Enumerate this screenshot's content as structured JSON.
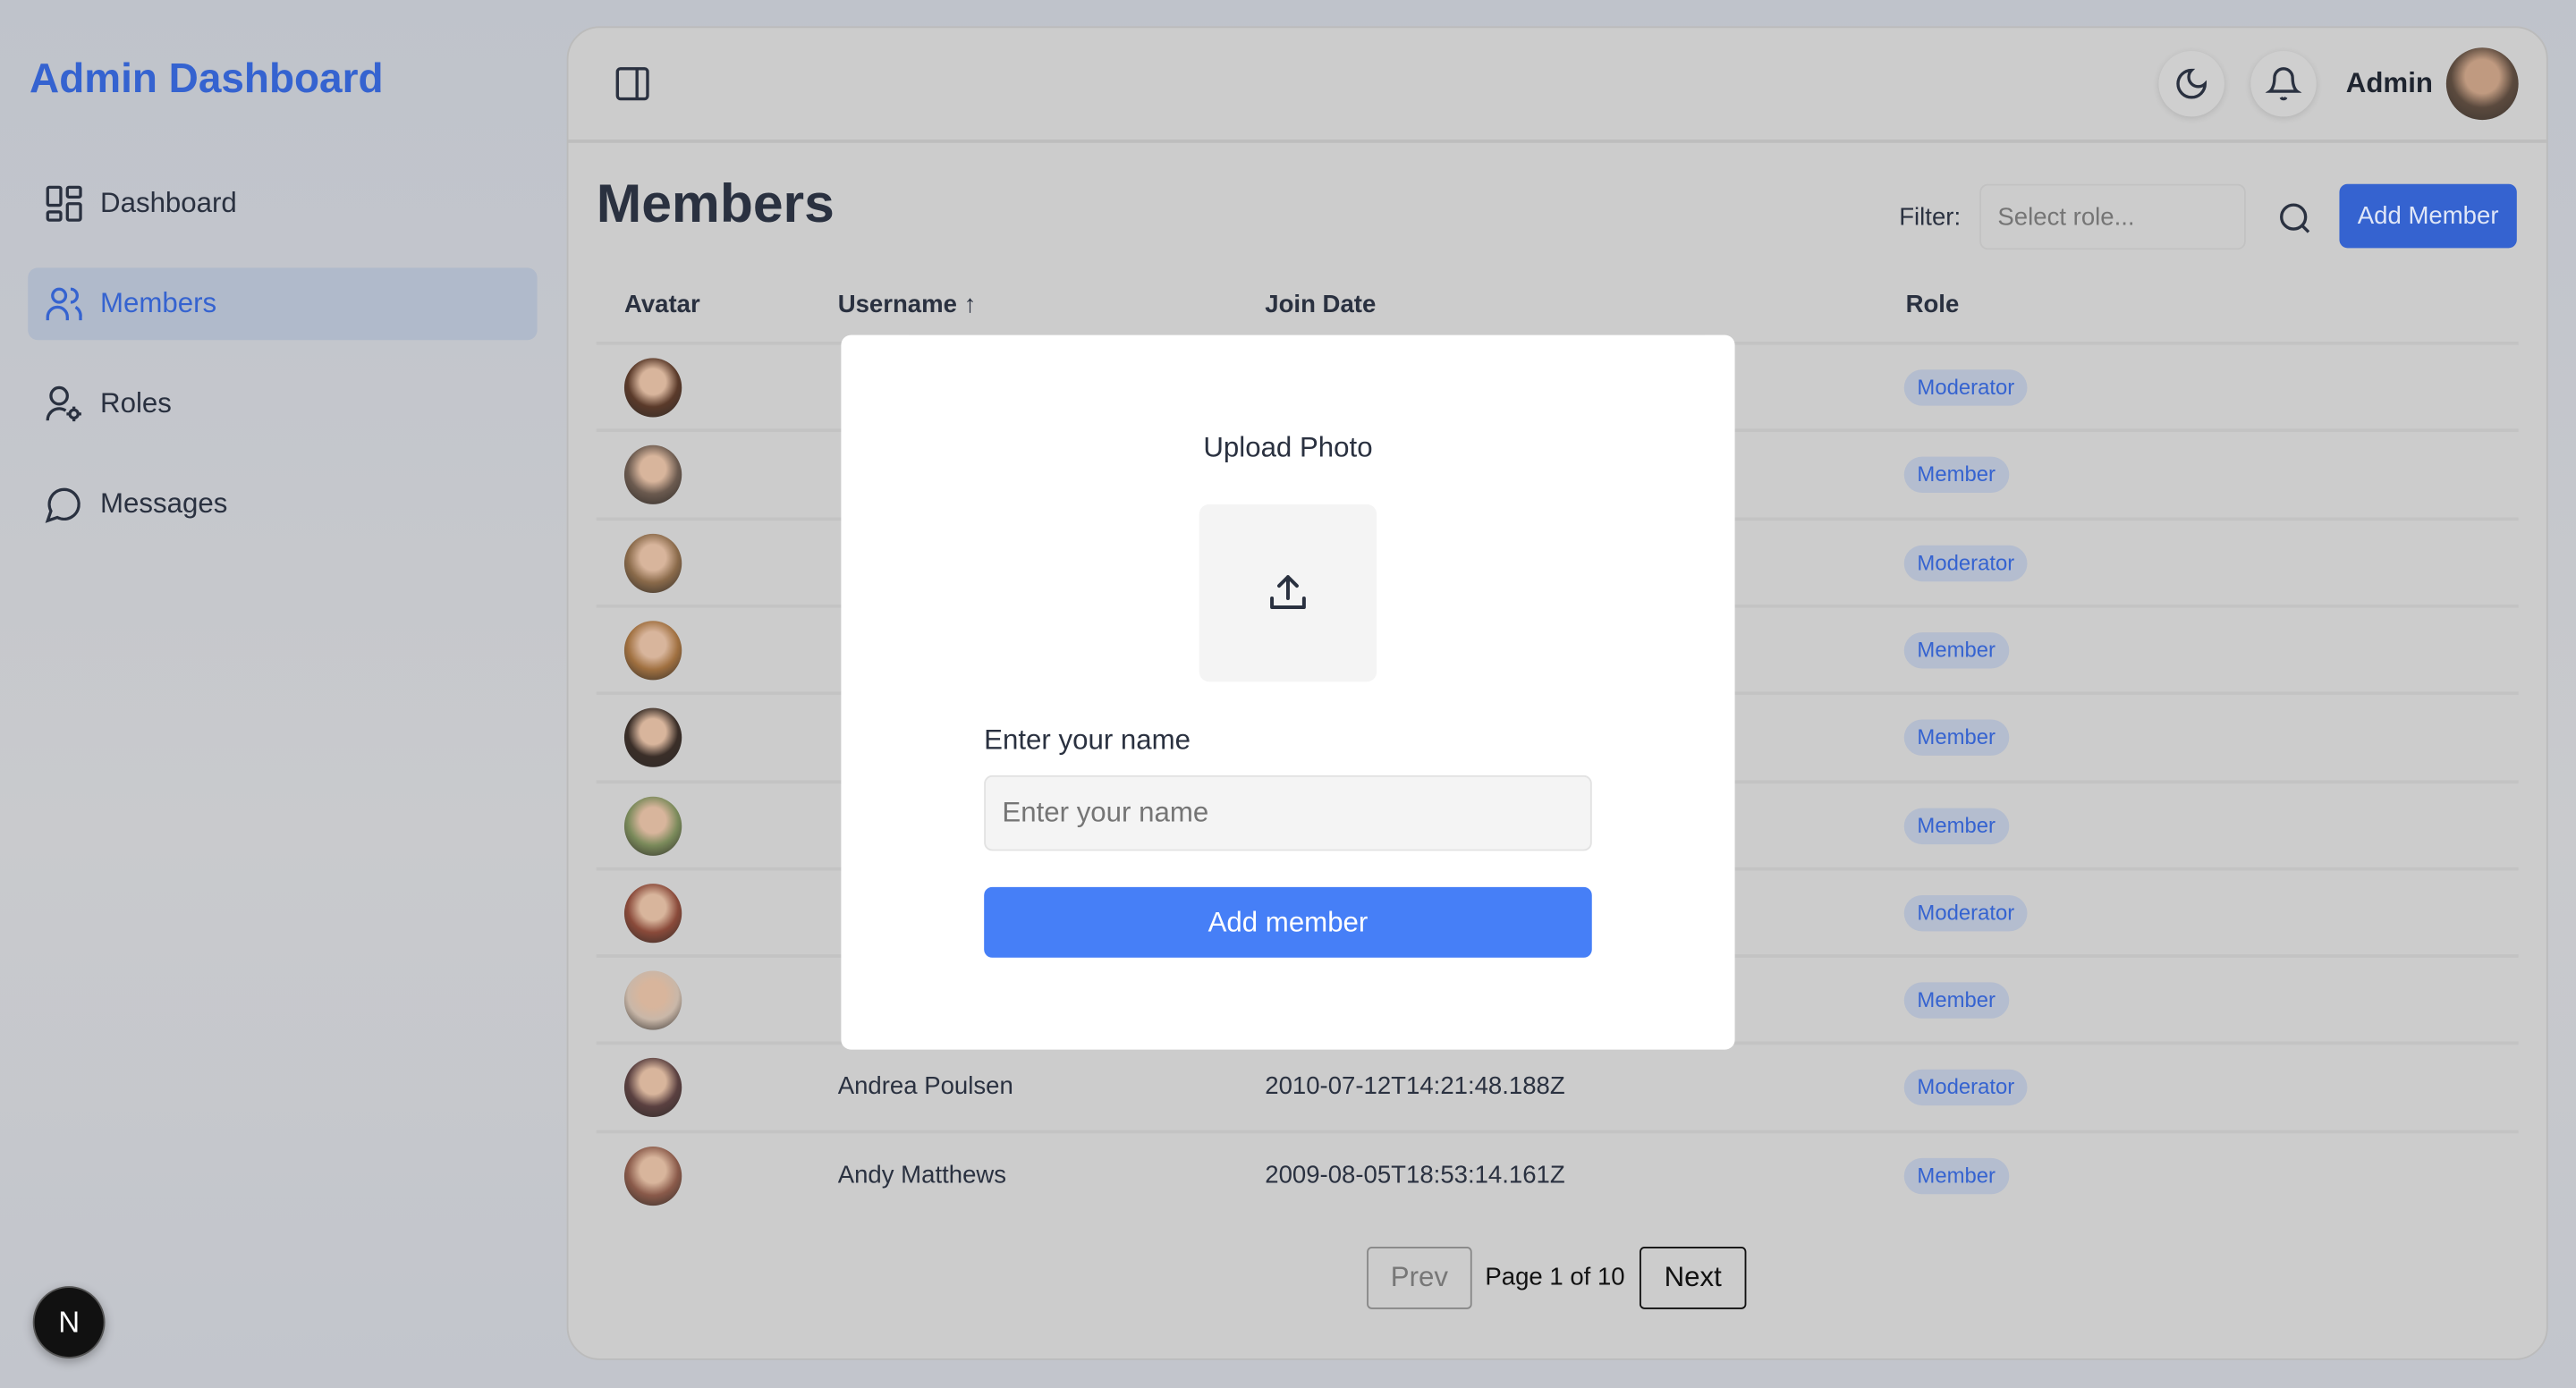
{
  "sidebar": {
    "brand": "Admin Dashboard",
    "items": [
      {
        "label": "Dashboard",
        "icon": "dashboard-grid-icon",
        "active": false
      },
      {
        "label": "Members",
        "icon": "users-icon",
        "active": true
      },
      {
        "label": "Roles",
        "icon": "user-gear-icon",
        "active": false
      },
      {
        "label": "Messages",
        "icon": "chat-bubble-icon",
        "active": false
      }
    ],
    "badge_letter": "N"
  },
  "header": {
    "user_name": "Admin"
  },
  "main": {
    "title": "Members",
    "filter_label": "Filter:",
    "filter_placeholder": "Select role...",
    "add_button": "Add Member",
    "columns": [
      "Avatar",
      "Username ↑",
      "Join Date",
      "Role"
    ],
    "rows": [
      {
        "username": "",
        "join_date": "",
        "role": "Moderator",
        "avatar_color": "#5a3a2a"
      },
      {
        "username": "",
        "join_date": "",
        "role": "Member",
        "avatar_color": "#6b5a4f"
      },
      {
        "username": "",
        "join_date": "",
        "role": "Moderator",
        "avatar_color": "#8a6a4a"
      },
      {
        "username": "",
        "join_date": "",
        "role": "Member",
        "avatar_color": "#a07040"
      },
      {
        "username": "",
        "join_date": "",
        "role": "Member",
        "avatar_color": "#3a2e28"
      },
      {
        "username": "",
        "join_date": "",
        "role": "Member",
        "avatar_color": "#7a8a5a"
      },
      {
        "username": "",
        "join_date": "",
        "role": "Moderator",
        "avatar_color": "#8a4a3a"
      },
      {
        "username": "",
        "join_date": "",
        "role": "Member",
        "avatar_color": "#c9b7a8"
      },
      {
        "username": "Andrea Poulsen",
        "join_date": "2010-07-12T14:21:48.188Z",
        "role": "Moderator",
        "avatar_color": "#5a4040"
      },
      {
        "username": "Andy Matthews",
        "join_date": "2009-08-05T18:53:14.161Z",
        "role": "Member",
        "avatar_color": "#8a5a4a"
      }
    ],
    "pagination": {
      "prev": "Prev",
      "status": "Page 1 of 10",
      "next": "Next"
    }
  },
  "modal": {
    "upload_label": "Upload Photo",
    "name_label": "Enter your name",
    "name_placeholder": "Enter your name",
    "name_value": "",
    "submit": "Add member"
  },
  "colors": {
    "accent": "#3563d0",
    "modal_button": "#467ff7",
    "badge_bg": "#b4bdcf"
  }
}
